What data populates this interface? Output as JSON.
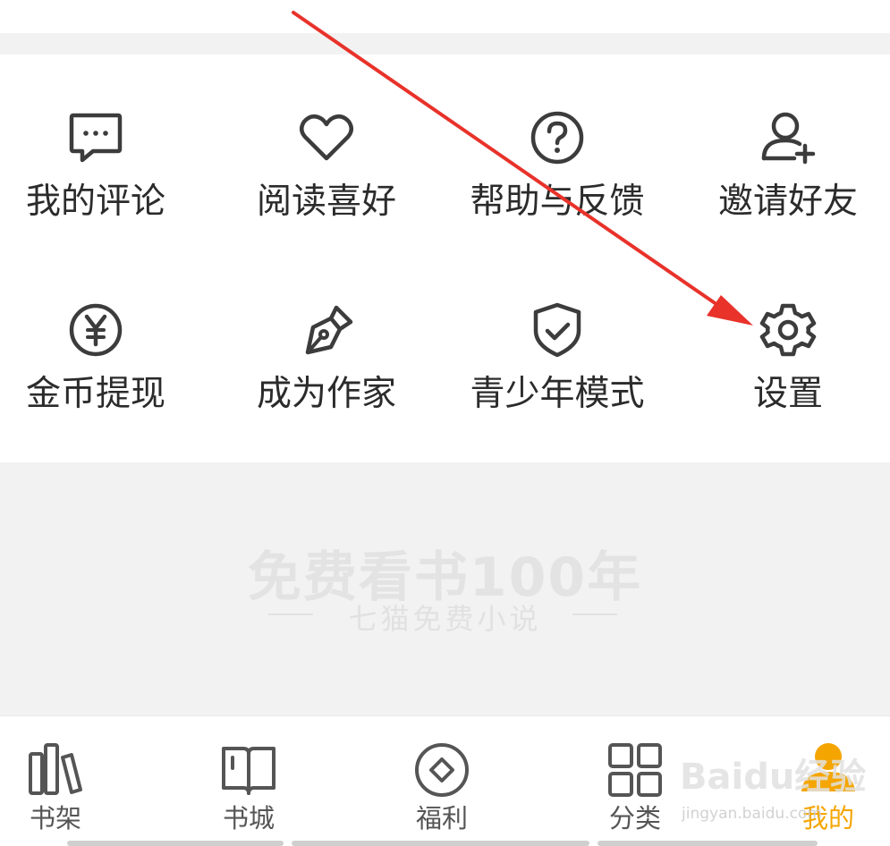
{
  "menu": {
    "items": [
      {
        "label": "我的评论",
        "icon": "comment-icon"
      },
      {
        "label": "阅读喜好",
        "icon": "heart-icon"
      },
      {
        "label": "帮助与反馈",
        "icon": "help-icon"
      },
      {
        "label": "邀请好友",
        "icon": "add-user-icon"
      },
      {
        "label": "金币提现",
        "icon": "coin-yen-icon"
      },
      {
        "label": "成为作家",
        "icon": "pen-nib-icon"
      },
      {
        "label": "青少年模式",
        "icon": "shield-check-icon"
      },
      {
        "label": "设置",
        "icon": "gear-icon"
      }
    ]
  },
  "promo": {
    "title": "免费看书100年",
    "subtitle": "七猫免费小说"
  },
  "tabbar": {
    "tabs": [
      {
        "label": "书架",
        "icon": "bookshelf-icon"
      },
      {
        "label": "书城",
        "icon": "book-icon"
      },
      {
        "label": "福利",
        "icon": "diamond-coin-icon"
      },
      {
        "label": "分类",
        "icon": "grid-icon"
      },
      {
        "label": "我的",
        "icon": "person-icon"
      }
    ],
    "active": "我的"
  },
  "annotation": {
    "arrow_color": "#e8322a"
  },
  "watermark": {
    "text": "Baidu经验",
    "sub": "jingyan.baidu.com"
  },
  "colors": {
    "accent": "#f5a500",
    "icon": "#3c3c3c",
    "text": "#2b2b2b"
  }
}
